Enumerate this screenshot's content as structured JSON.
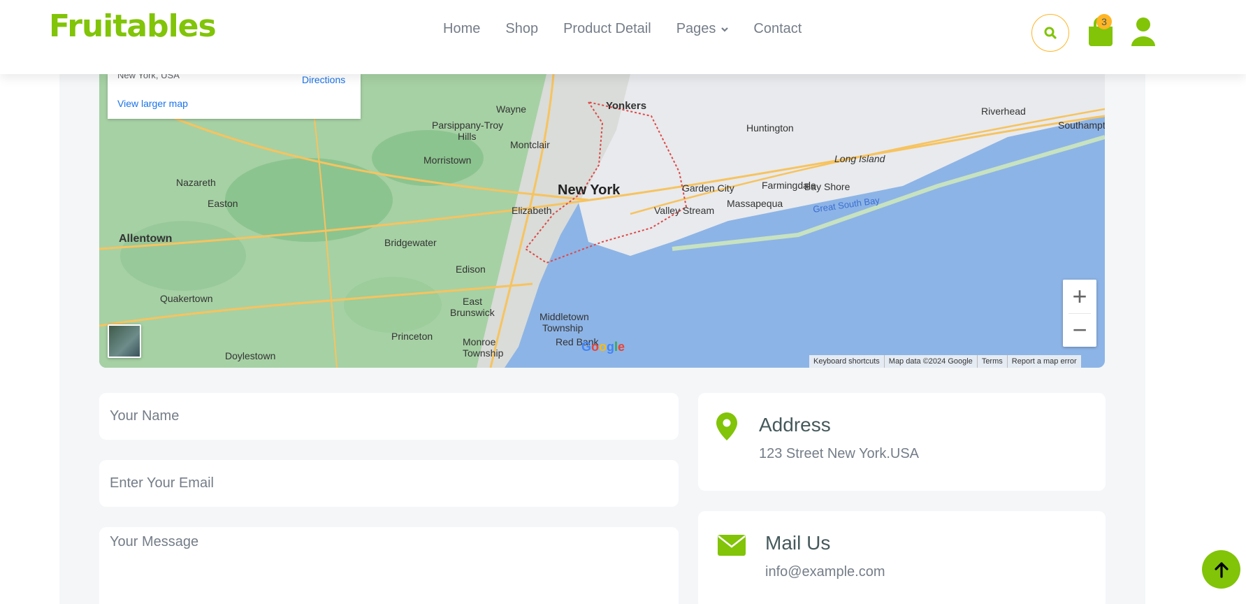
{
  "brand": "Fruitables",
  "nav": {
    "items": [
      {
        "label": "Home"
      },
      {
        "label": "Shop"
      },
      {
        "label": "Product Detail"
      },
      {
        "label": "Pages"
      },
      {
        "label": "Contact"
      }
    ],
    "cart_count": "3"
  },
  "map": {
    "place_address": "New York, USA",
    "directions_label": "Directions",
    "view_larger_label": "View larger map",
    "labels": [
      "Yonkers",
      "Wayne",
      "Parsippany-Troy Hills",
      "Huntington",
      "Riverhead",
      "Southampton",
      "Montclair",
      "Morristown",
      "New York",
      "Garden City",
      "Farmingdale",
      "Bay Shore",
      "Long Island",
      "Nazareth",
      "Easton",
      "Elizabeth",
      "Valley Stream",
      "Massapequa",
      "Great South Bay",
      "Allentown",
      "Bridgewater",
      "Edison",
      "East Brunswick",
      "Middletown Township",
      "Quakertown",
      "Princeton",
      "Monroe Township",
      "Red Bank",
      "Doylestown"
    ],
    "attribution": [
      "Keyboard shortcuts",
      "Map data ©2024 Google",
      "Terms",
      "Report a map error"
    ],
    "zoom_in": "+",
    "zoom_out": "−"
  },
  "form": {
    "name_placeholder": "Your Name",
    "email_placeholder": "Enter Your Email",
    "message_placeholder": "Your Message"
  },
  "contact": {
    "address_title": "Address",
    "address_value": "123 Street New York.USA",
    "mail_title": "Mail Us",
    "mail_value": "info@example.com"
  },
  "colors": {
    "primary": "#81c408",
    "secondary": "#ffb524",
    "text": "#45595b"
  }
}
